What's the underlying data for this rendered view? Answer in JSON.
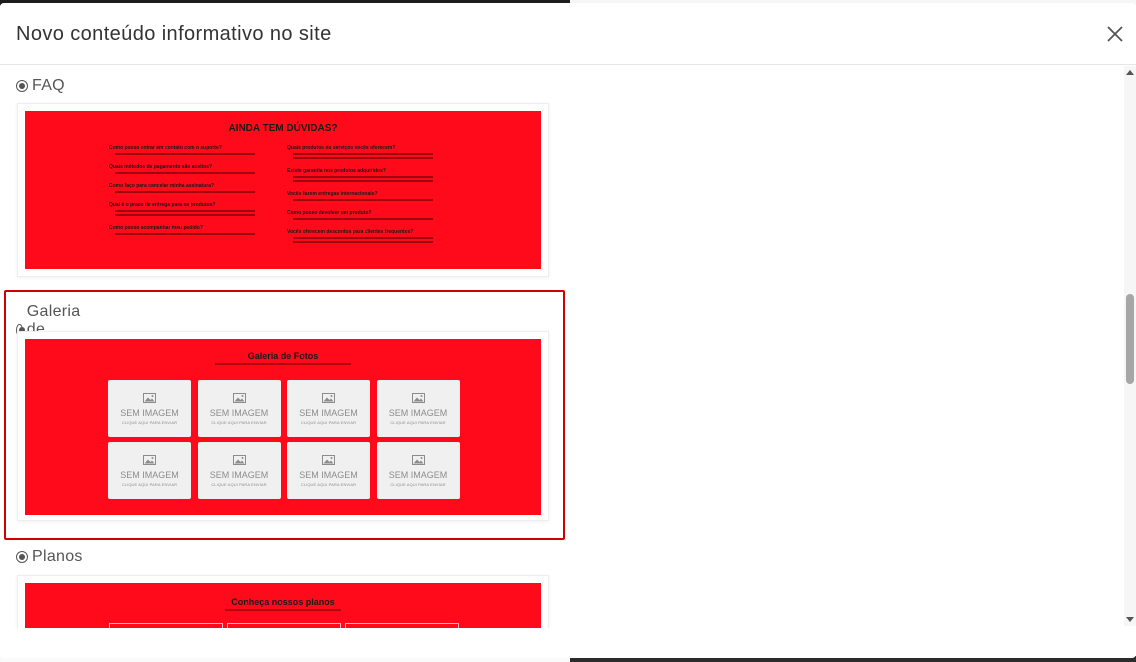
{
  "modal": {
    "title": "Novo conteúdo informativo no site",
    "close_label": "×"
  },
  "sections": [
    {
      "label": "FAQ",
      "selected": false,
      "preview": {
        "title": "AINDA TEM DÚVIDAS?",
        "questions_left": [
          "Como posso entrar em contato com o suporte?",
          "Quais métodos de pagamento são aceitos?",
          "Como faço para cancelar minha assinatura?",
          "Qual é o prazo de entrega para os produtos?",
          "Como posso acompanhar meu pedido?"
        ],
        "questions_right": [
          "Quais produtos ou serviços vocês oferecem?",
          "Existe garantia nos produtos adquiridos?",
          "Vocês fazem entregas internacionais?",
          "Como posso devolver um produto?",
          "Vocês oferecem descontos para clientes frequentes?"
        ]
      }
    },
    {
      "label": "Galeria de Fotos",
      "selected": true,
      "preview": {
        "title": "Galeria de Fotos",
        "tiles": [
          {
            "main": "SEM IMAGEM",
            "sub": "CLIQUE AQUI PARA ENVIAR"
          },
          {
            "main": "SEM IMAGEM",
            "sub": "CLIQUE AQUI PARA ENVIAR"
          },
          {
            "main": "SEM IMAGEM",
            "sub": "CLIQUE AQUI PARA ENVIAR"
          },
          {
            "main": "SEM IMAGEM",
            "sub": "CLIQUE AQUI PARA ENVIAR"
          },
          {
            "main": "SEM IMAGEM",
            "sub": "CLIQUE AQUI PARA ENVIAR"
          },
          {
            "main": "SEM IMAGEM",
            "sub": "CLIQUE AQUI PARA ENVIAR"
          },
          {
            "main": "SEM IMAGEM",
            "sub": "CLIQUE AQUI PARA ENVIAR"
          },
          {
            "main": "SEM IMAGEM",
            "sub": "CLIQUE AQUI PARA ENVIAR"
          }
        ]
      }
    },
    {
      "label": "Planos",
      "selected": false,
      "preview": {
        "title": "Conheça nossos planos"
      }
    }
  ],
  "colors": {
    "preview_background": "#ff0a1a",
    "selection_border": "#d10000"
  }
}
